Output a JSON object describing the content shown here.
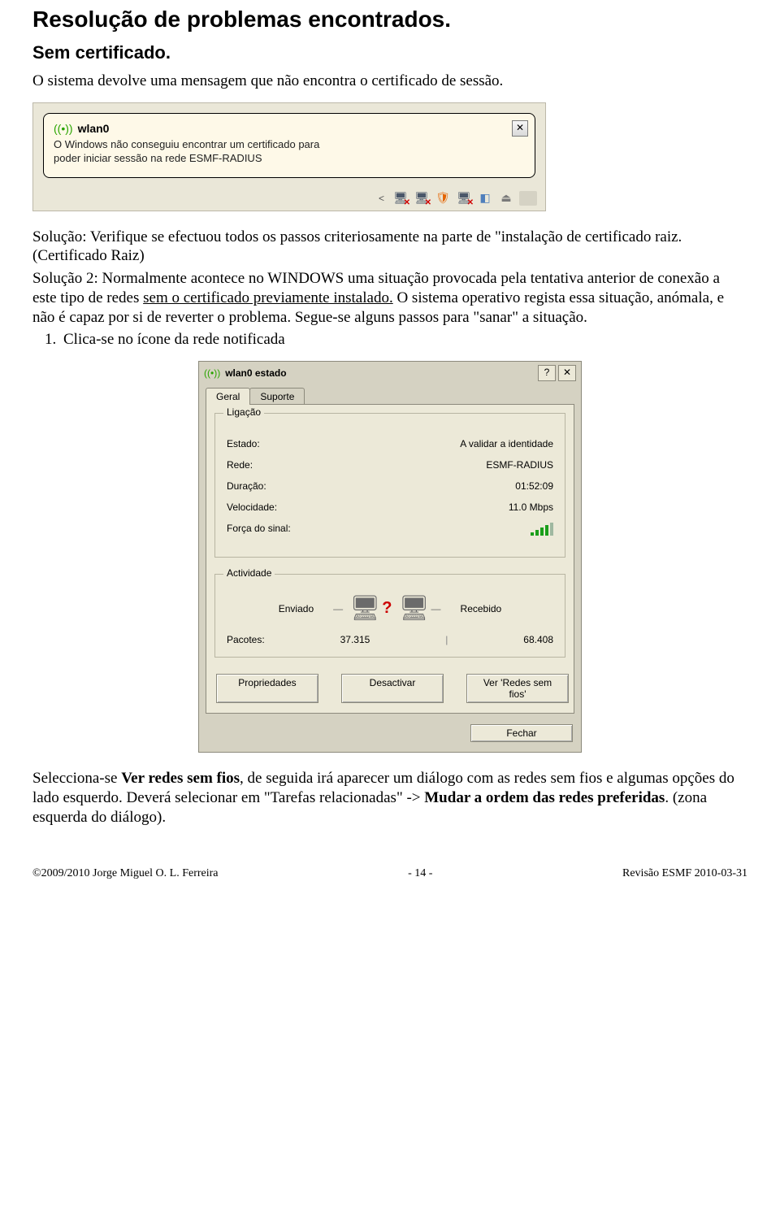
{
  "heading1": "Resolução de problemas encontrados.",
  "heading2": "Sem certificado.",
  "para1": "O sistema devolve uma mensagem que não encontra o certificado de sessão.",
  "balloon": {
    "title": "wlan0",
    "line1": "O Windows não conseguiu encontrar um certificado para",
    "line2": "poder iniciar sessão na rede ESMF-RADIUS"
  },
  "para2a": "Solução: Verifique se efectuou todos os passos criteriosamente na parte de \"instalação de certificado raiz. (Certificado Raiz)",
  "para3a": "Solução 2: Normalmente acontece no WINDOWS uma situação provocada pela tentativa anterior de conexão a este tipo de redes ",
  "para3u": "sem o certificado previamente instalado.",
  "para3b": " O sistema operativo regista essa situação, anómala, e não é capaz por si de reverter o problema. Segue-se alguns passos para \"sanar\" a situação.",
  "list1_item1": "Clica-se no ícone da rede notificada",
  "dialog": {
    "title": "wlan0 estado",
    "tab_geral": "Geral",
    "tab_suporte": "Suporte",
    "group_ligacao": "Ligação",
    "label_estado": "Estado:",
    "val_estado": "A validar a identidade",
    "label_rede": "Rede:",
    "val_rede": "ESMF-RADIUS",
    "label_duracao": "Duração:",
    "val_duracao": "01:52:09",
    "label_velocidade": "Velocidade:",
    "val_velocidade": "11.0 Mbps",
    "label_forca": "Força do sinal:",
    "group_actividade": "Actividade",
    "act_enviado": "Enviado",
    "act_recebido": "Recebido",
    "label_pacotes": "Pacotes:",
    "val_pkts_env": "37.315",
    "val_pkts_rec": "68.408",
    "btn_prop": "Propriedades",
    "btn_desact": "Desactivar",
    "btn_ver": "Ver 'Redes sem fios'",
    "btn_fechar": "Fechar"
  },
  "para4a": "Selecciona-se ",
  "para4b": "Ver redes sem fios",
  "para4c": ", de seguida irá aparecer um diálogo com as redes sem fios e algumas opções do lado esquerdo. Deverá selecionar em \"Tarefas relacionadas\" -> ",
  "para4d": "Mudar a ordem das redes preferidas",
  "para4e": ". (zona esquerda do diálogo).",
  "footer": {
    "left": "©2009/2010 Jorge Miguel O. L. Ferreira",
    "center": "- 14 -",
    "right": "Revisão ESMF 2010-03-31"
  }
}
